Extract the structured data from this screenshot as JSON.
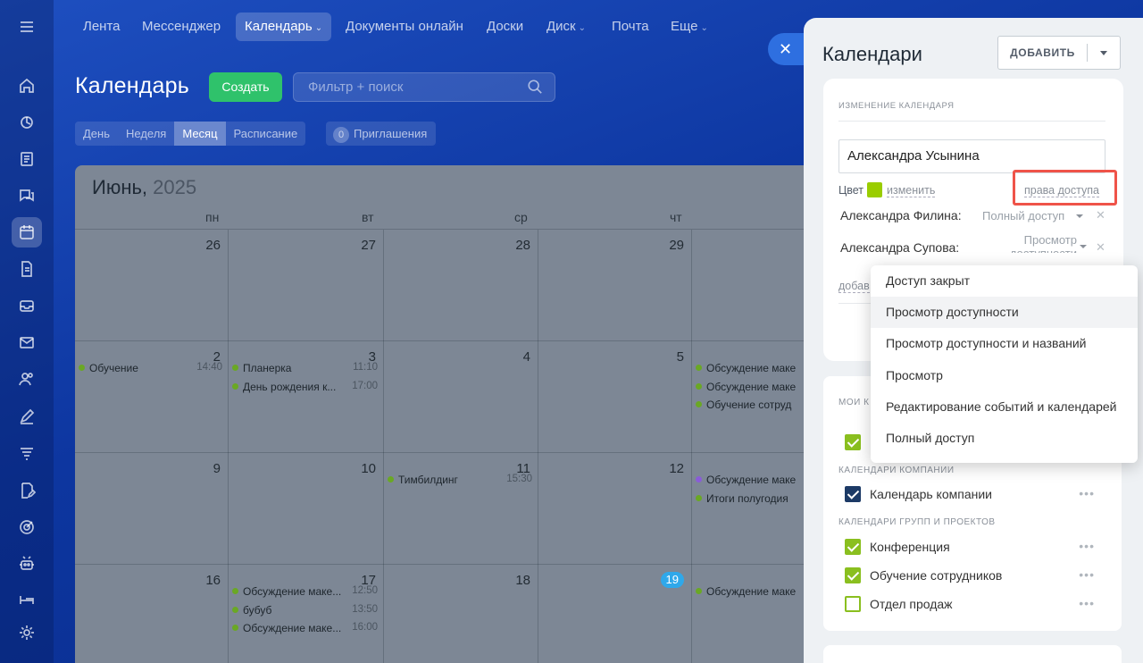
{
  "nav": {
    "items": [
      {
        "label": "Лента"
      },
      {
        "label": "Мессенджер"
      },
      {
        "label": "Календарь"
      },
      {
        "label": "Документы онлайн"
      },
      {
        "label": "Доски"
      },
      {
        "label": "Диск"
      },
      {
        "label": "Почта"
      },
      {
        "label": "Еще"
      }
    ]
  },
  "header": {
    "title": "Календарь",
    "create_label": "Создать",
    "search_placeholder": "Фильтр + поиск",
    "views": [
      "День",
      "Неделя",
      "Месяц",
      "Расписание"
    ],
    "active_view": "Месяц",
    "invites_count": "0",
    "invites_label": "Приглашения"
  },
  "calendar": {
    "month": "Июнь,",
    "year": "2025",
    "weekdays": [
      "пн",
      "вт",
      "ср",
      "чт"
    ],
    "weeks": [
      {
        "days": [
          "26",
          "27",
          "28",
          "29"
        ]
      },
      {
        "days": [
          "2",
          "3",
          "4",
          "5"
        ]
      },
      {
        "days": [
          "9",
          "10",
          "11",
          "12"
        ]
      },
      {
        "days": [
          "16",
          "17",
          "18",
          "19"
        ]
      }
    ],
    "today": "19",
    "events": {
      "w1d0": [
        {
          "title": "Обучение",
          "time": "14:40"
        }
      ],
      "w1d1": [
        {
          "title": "Планерка",
          "time": "11:10"
        },
        {
          "title": "День рождения к...",
          "time": "17:00"
        }
      ],
      "w1d4": [
        {
          "title": "Обсуждение маке"
        },
        {
          "title": "Обсуждение маке"
        },
        {
          "title": "Обучение сотруд"
        }
      ],
      "w2d2": [
        {
          "title": "Тимбилдинг",
          "time": "15:30"
        }
      ],
      "w2d4": [
        {
          "title": "Обсуждение маке"
        },
        {
          "title": "Итоги полугодия"
        }
      ],
      "w3d1": [
        {
          "title": "Обсуждение маке...",
          "time": "12:50"
        },
        {
          "title": "бубуб",
          "time": "13:50"
        },
        {
          "title": "Обсуждение маке...",
          "time": "16:00"
        }
      ],
      "w3d4": [
        {
          "title": "Обсуждение маке"
        }
      ]
    }
  },
  "slider": {
    "title": "Календари",
    "add_label": "ДОБАВИТЬ",
    "edit": {
      "section_title": "ИЗМЕНЕНИЕ КАЛЕНДАРЯ",
      "name_value": "Александра Усынина",
      "color_label": "Цвет",
      "color": "#9acd00",
      "change_label": "изменить",
      "access_link": "права доступа",
      "access": [
        {
          "name": "Александра Филина:",
          "level": "Полный доступ"
        },
        {
          "name": "Александра Супова:",
          "level": "Просмотр доступности"
        }
      ],
      "add_access_label": "добав"
    },
    "sections": {
      "my_title": "МОИ К",
      "company_title": "КАЛЕНДАРИ КОМПАНИИ",
      "groups_title": "КАЛЕНДАРИ ГРУПП И ПРОЕКТОВ"
    },
    "company_calendars": [
      {
        "label": "Календарь компании"
      }
    ],
    "group_calendars": [
      {
        "label": "Конференция"
      },
      {
        "label": "Обучение сотрудников"
      },
      {
        "label": "Отдел продаж"
      }
    ]
  },
  "dropdown": {
    "options": [
      "Доступ закрыт",
      "Просмотр доступности",
      "Просмотр доступности и названий",
      "Просмотр",
      "Редактирование событий и календарей",
      "Полный доступ"
    ],
    "hovered": "Просмотр доступности"
  },
  "icons": [
    "menu-icon",
    "home-icon",
    "feed-icon",
    "tasks-icon",
    "chat-icon",
    "calendar-icon",
    "document-icon",
    "inbox-icon",
    "mail-icon",
    "people-icon",
    "sign-icon",
    "filter-icon",
    "edit-doc-icon",
    "target-icon",
    "robot-icon",
    "bed-icon",
    "settings-icon"
  ]
}
